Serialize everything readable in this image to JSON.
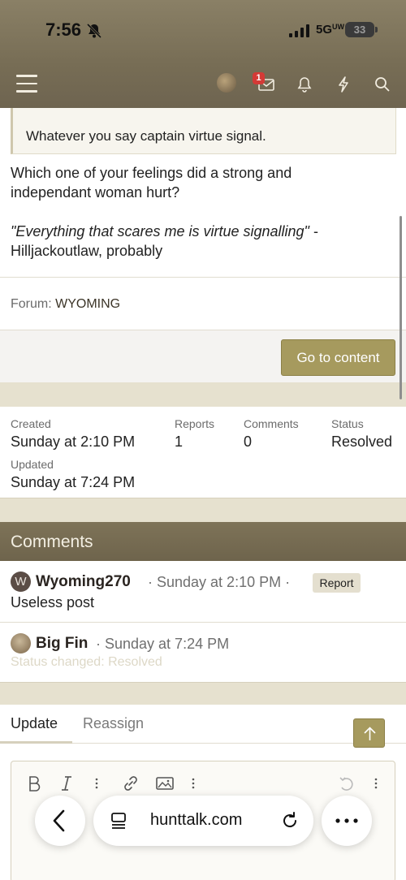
{
  "status_bar": {
    "time": "7:56",
    "network": "5G",
    "network_suffix": "UW",
    "battery": "33"
  },
  "header": {
    "menu_icon": "hamburger-menu-icon",
    "conversations_badge": "1",
    "icons": [
      "avatar",
      "inbox-icon",
      "bell-icon",
      "lightning-icon",
      "search-icon"
    ]
  },
  "post": {
    "quote_text": "Whatever you say captain virtue signal.",
    "line1": "Which one of your feelings did a strong and",
    "line2": "independant woman hurt?",
    "italic_line": "\"Everything that scares me is virtue signalling\"",
    "italic_suffix": " -",
    "attribution": "Hilljackoutlaw, probably",
    "forum_label": "Forum:",
    "forum_value": "WYOMING",
    "goto_button": "Go to content"
  },
  "info": {
    "created_label": "Created",
    "created_value": "Sunday at 2:10 PM",
    "reports_label": "Reports",
    "reports_value": "1",
    "comments_label": "Comments",
    "comments_value": "0",
    "status_label": "Status",
    "status_value": "Resolved",
    "updated_label": "Updated",
    "updated_value": "Sunday at 7:24 PM"
  },
  "comments": {
    "title": "Comments",
    "items": [
      {
        "avatar_letter": "W",
        "author": "Wyoming270",
        "meta": "· Sunday at 2:10 PM ·",
        "badge": "Report",
        "body": "Useless post"
      },
      {
        "author": "Big Fin",
        "meta": "· Sunday at 7:24 PM",
        "body": "Status changed: Resolved"
      }
    ]
  },
  "tabs": {
    "items": [
      "Update",
      "Reassign"
    ]
  },
  "editor": {
    "tools": [
      "bold-icon",
      "italic-icon",
      "more-vertical-icon",
      "link-icon",
      "image-icon",
      "more-vertical-icon",
      "undo-icon",
      "more-vertical-icon"
    ]
  },
  "browser": {
    "url": "hunttalk.com"
  }
}
